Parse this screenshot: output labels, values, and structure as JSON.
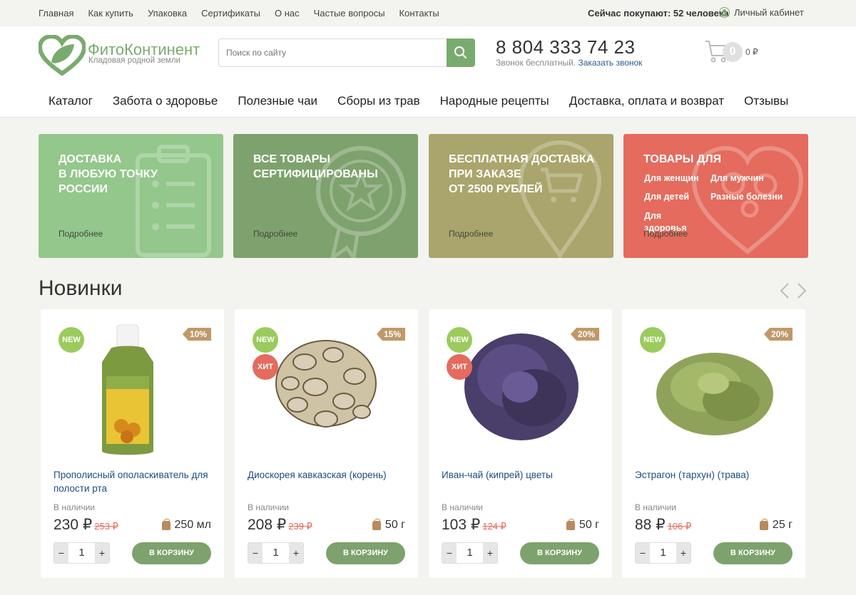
{
  "topnav": [
    "Главная",
    "Как купить",
    "Упаковка",
    "Сертификаты",
    "О нас",
    "Частые вопросы",
    "Контакты"
  ],
  "buying_now": "Сейчас покупают: 52 человека",
  "cabinet": "Личный кабинет",
  "brand": {
    "name": "ФитоКонтинент",
    "tagline": "Кладовая родной земли"
  },
  "search": {
    "placeholder": "Поиск по сайту"
  },
  "phone": {
    "number": "8 804 333 74 23",
    "note": "Звонок бесплатный.",
    "callback": "Заказать звонок"
  },
  "cart": {
    "count": "0",
    "sum": "0 ₽"
  },
  "mainnav": [
    "Каталог",
    "Забота о здоровье",
    "Полезные чаи",
    "Сборы из трав",
    "Народные рецепты",
    "Доставка, оплата и возврат",
    "Отзывы"
  ],
  "banners": [
    {
      "title_lines": [
        "ДОСТАВКА",
        "В ЛЮБУЮ ТОЧКУ",
        "РОССИИ"
      ],
      "more": "Подробнее"
    },
    {
      "title_lines": [
        "ВСЕ ТОВАРЫ",
        "СЕРТИФИЦИРОВАНЫ"
      ],
      "more": "Подробнее"
    },
    {
      "title_lines": [
        "БЕСПЛАТНАЯ ДОСТАВКА",
        "ПРИ ЗАКАЗЕ",
        "ОТ 2500 РУБЛЕЙ"
      ],
      "more": "Подробнее"
    },
    {
      "title_lines": [
        "ТОВАРЫ ДЛЯ"
      ],
      "more": "Подробнее",
      "links": [
        "Для женщин",
        "Для мужчин",
        "Для детей",
        "Разные болезни",
        "Для здоровья"
      ]
    }
  ],
  "section_title": "Новинки",
  "products": [
    {
      "name": "Прополисный ополаскиватель для полости рта",
      "stock": "В наличии",
      "price": "230 ₽",
      "old_price": "253 ₽",
      "weight": "250 мл",
      "qty": "1",
      "discount": "10%",
      "new": "NEW",
      "hit": "",
      "to_cart": "В КОРЗИНУ"
    },
    {
      "name": "Диоскорея кавказская (корень)",
      "stock": "В наличии",
      "price": "208 ₽",
      "old_price": "239 ₽",
      "weight": "50 г",
      "qty": "1",
      "discount": "15%",
      "new": "NEW",
      "hit": "ХИТ",
      "to_cart": "В КОРЗИНУ"
    },
    {
      "name": "Иван-чай (кипрей) цветы",
      "stock": "В наличии",
      "price": "103 ₽",
      "old_price": "124 ₽",
      "weight": "50 г",
      "qty": "1",
      "discount": "20%",
      "new": "NEW",
      "hit": "ХИТ",
      "to_cart": "В КОРЗИНУ"
    },
    {
      "name": "Эстрагон (тархун) (трава)",
      "stock": "В наличии",
      "price": "88 ₽",
      "old_price": "106 ₽",
      "weight": "25 г",
      "qty": "1",
      "discount": "20%",
      "new": "NEW",
      "hit": "",
      "to_cart": "В КОРЗИНУ"
    }
  ],
  "colors": {
    "accent": "#7aab6e",
    "red": "#e46b5d",
    "link": "#1f4b7f"
  }
}
